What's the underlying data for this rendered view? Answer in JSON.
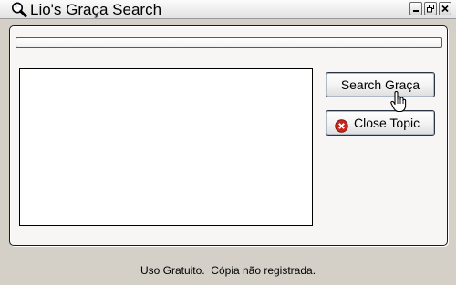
{
  "window": {
    "title": "Lio's Graça Search",
    "title_icon": "magnifier-icon",
    "controls": [
      "minimize-icon",
      "restore-icon",
      "close-icon"
    ]
  },
  "panel": {
    "progress_percent": 0,
    "results_list": [],
    "buttons": {
      "search_label": "Search Graça",
      "close_label": "Close Topic",
      "close_icon": "red-x-circle-icon"
    }
  },
  "status_bar": {
    "text": "Uso Gratuito.  Cópia não registrada."
  },
  "colors": {
    "window_background": "#d4d0c8",
    "panel_background": "#f7f6f4",
    "close_icon_red": "#c8271b"
  }
}
